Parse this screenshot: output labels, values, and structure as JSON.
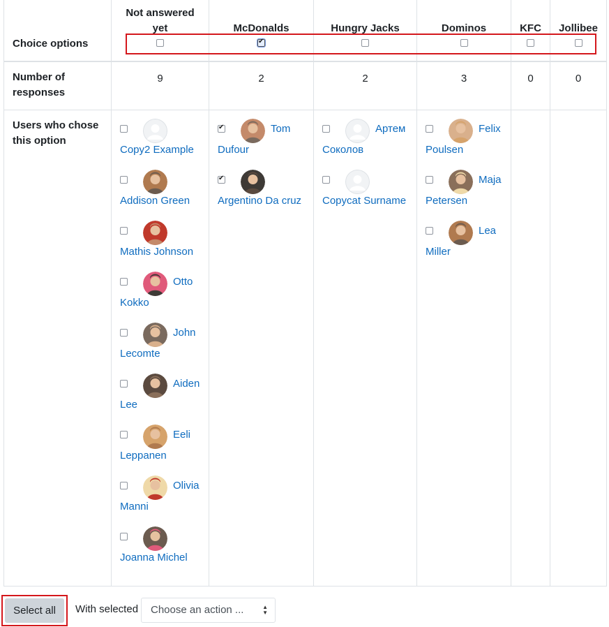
{
  "table": {
    "row_labels": {
      "choice_options": "Choice options",
      "number_of_responses_1": "Number of",
      "number_of_responses_2": "responses",
      "users_chose_1": "Users who chose",
      "users_chose_2": "this option"
    },
    "columns": [
      {
        "header_1": "Not answered",
        "header_2": "yet",
        "count": "9",
        "selected": false
      },
      {
        "header_1": "McDonalds",
        "header_2": "",
        "count": "2",
        "selected": true
      },
      {
        "header_1": "Hungry Jacks",
        "header_2": "",
        "count": "2",
        "selected": false
      },
      {
        "header_1": "Dominos",
        "header_2": "",
        "count": "3",
        "selected": false
      },
      {
        "header_1": "KFC",
        "header_2": "",
        "count": "0",
        "selected": false
      },
      {
        "header_1": "Jollibee",
        "header_2": "",
        "count": "0",
        "selected": false
      }
    ],
    "users": {
      "not_answered": [
        {
          "l1": "",
          "l2": "Copy2 Example",
          "checked": false,
          "avatar": "default-avatar-icon"
        },
        {
          "l1": "",
          "l2": "Addison Green",
          "checked": false,
          "avatar": "user-photo"
        },
        {
          "l1": "",
          "l2": "Mathis Johnson",
          "checked": false,
          "avatar": "user-photo"
        },
        {
          "l1": "Otto",
          "l2": "Kokko",
          "checked": false,
          "avatar": "user-photo"
        },
        {
          "l1": "John",
          "l2": "Lecomte",
          "checked": false,
          "avatar": "user-photo"
        },
        {
          "l1": "Aiden",
          "l2": "Lee",
          "checked": false,
          "avatar": "user-photo"
        },
        {
          "l1": "Eeli",
          "l2": "Leppanen",
          "checked": false,
          "avatar": "user-photo"
        },
        {
          "l1": "Olivia",
          "l2": "Manni",
          "checked": false,
          "avatar": "user-photo"
        },
        {
          "l1": "",
          "l2": "Joanna Michel",
          "checked": false,
          "avatar": "user-photo"
        }
      ],
      "mcdonalds": [
        {
          "l1": "Tom",
          "l2": "Dufour",
          "checked": true,
          "avatar": "user-photo"
        },
        {
          "l1": "",
          "l2": "Argentino Da cruz",
          "checked": true,
          "avatar": "user-photo"
        }
      ],
      "hungry_jacks": [
        {
          "l1": "Артем",
          "l2": "Соколов",
          "checked": false,
          "avatar": "default-avatar-icon"
        },
        {
          "l1": "",
          "l2": "Copycat Surname",
          "checked": false,
          "avatar": "default-avatar-icon"
        }
      ],
      "dominos": [
        {
          "l1": "Felix",
          "l2": "Poulsen",
          "checked": false,
          "avatar": "user-photo"
        },
        {
          "l1": "Maja",
          "l2": "Petersen",
          "checked": false,
          "avatar": "user-photo"
        },
        {
          "l1": "Lea",
          "l2": "Miller",
          "checked": false,
          "avatar": "user-photo"
        }
      ]
    }
  },
  "footer": {
    "select_all_label": "Select all",
    "with_selected_label": "With selected",
    "action_select_value": "Choose an action ..."
  },
  "colors": {
    "link": "#0f6cbf",
    "border": "#dee2e6",
    "highlight_box": "#d4171c",
    "button_bg": "#ced4da"
  }
}
